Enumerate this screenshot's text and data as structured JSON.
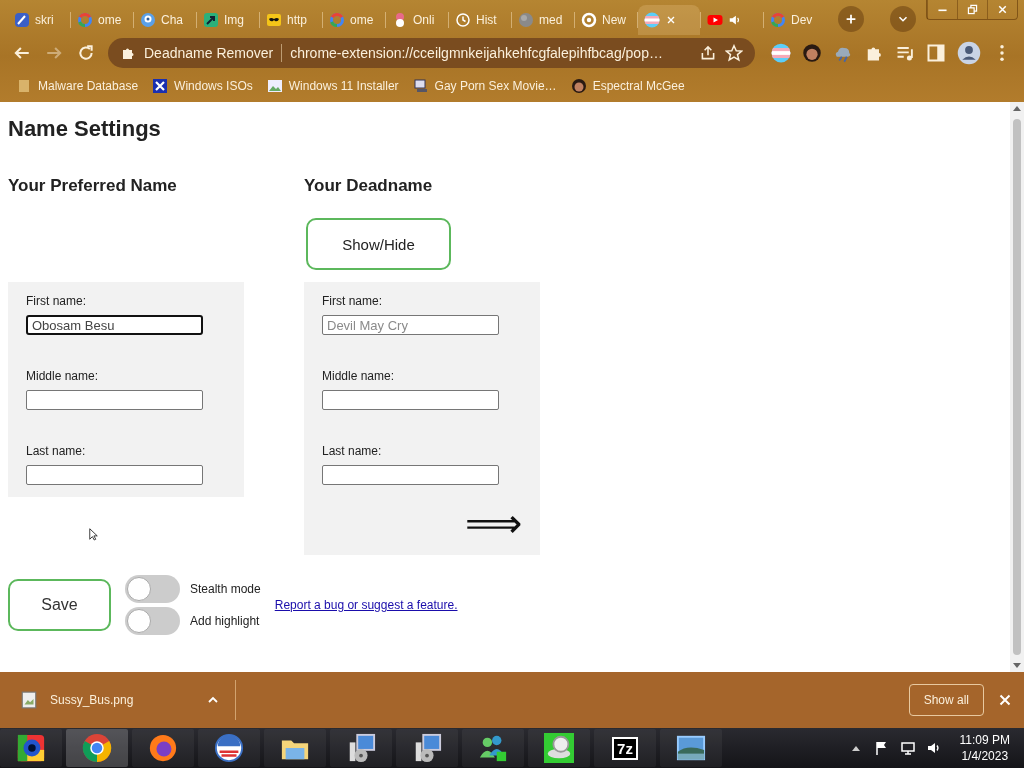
{
  "browser": {
    "tabs": [
      {
        "title": "skri",
        "selected": false,
        "audio": false
      },
      {
        "title": "ome",
        "selected": false,
        "audio": false
      },
      {
        "title": "Cha",
        "selected": false,
        "audio": false
      },
      {
        "title": "Img",
        "selected": false,
        "audio": false
      },
      {
        "title": "http",
        "selected": false,
        "audio": false
      },
      {
        "title": "ome",
        "selected": false,
        "audio": false
      },
      {
        "title": "Onli",
        "selected": false,
        "audio": false
      },
      {
        "title": "Hist",
        "selected": false,
        "audio": false
      },
      {
        "title": "med",
        "selected": false,
        "audio": false
      },
      {
        "title": "New",
        "selected": false,
        "audio": false
      },
      {
        "selected": true,
        "audio": false
      },
      {
        "selected": false,
        "audio": true
      },
      {
        "title": "Dev",
        "selected": false,
        "audio": false
      }
    ],
    "toolbar": {
      "nav": [
        {
          "kind": "back",
          "disabled": false
        },
        {
          "kind": "forward",
          "disabled": true
        },
        {
          "kind": "reload",
          "disabled": false
        }
      ],
      "site_name": "Deadname Remover",
      "url": "chrome-extension://cceilgmnkeijahkehfcgfalepihfbcag/pop…"
    },
    "bookmarks": [
      {
        "label": "Malware Database"
      },
      {
        "label": "Windows ISOs"
      },
      {
        "label": "Windows 11 Installer"
      },
      {
        "label": "Gay Porn Sex Movie…"
      },
      {
        "label": "Espectral McGee"
      }
    ]
  },
  "page": {
    "title": "Name Settings",
    "columns": [
      {
        "heading": "Your Preferred Name",
        "fields": [
          {
            "label": "First name:",
            "value": "Obosam Besu",
            "focused": true
          },
          {
            "label": "Middle name:",
            "focused": false
          },
          {
            "label": "Last name:",
            "focused": false
          }
        ]
      },
      {
        "heading": "Your Deadname",
        "button": "Show/Hide",
        "fields": [
          {
            "label": "First name:",
            "placeholder": "Devil May Cry",
            "focused": false
          },
          {
            "label": "Middle name:",
            "focused": false
          },
          {
            "label": "Last name:",
            "focused": false
          }
        ],
        "next_arrow": "⟹"
      }
    ],
    "save_button": "Save",
    "toggles": [
      {
        "label": "Stealth mode",
        "on": false
      },
      {
        "label": "Add highlight",
        "on": false
      }
    ],
    "feedback_link": "Report a bug or suggest a feature."
  },
  "downloads": {
    "items": [
      {
        "file": "Sussy_Bus.png"
      }
    ],
    "show_all": "Show all"
  },
  "taskbar": {
    "apps": [
      {
        "selected": false
      },
      {
        "selected": true
      },
      {
        "selected": false
      },
      {
        "selected": false
      },
      {
        "selected": false
      },
      {
        "selected": false
      },
      {
        "selected": false
      },
      {
        "selected": false
      },
      {
        "selected": false
      },
      {
        "label": "7z",
        "selected": false
      },
      {
        "selected": false
      }
    ],
    "clock": {
      "time": "11:09 PM",
      "date": "1/4/2023"
    }
  }
}
